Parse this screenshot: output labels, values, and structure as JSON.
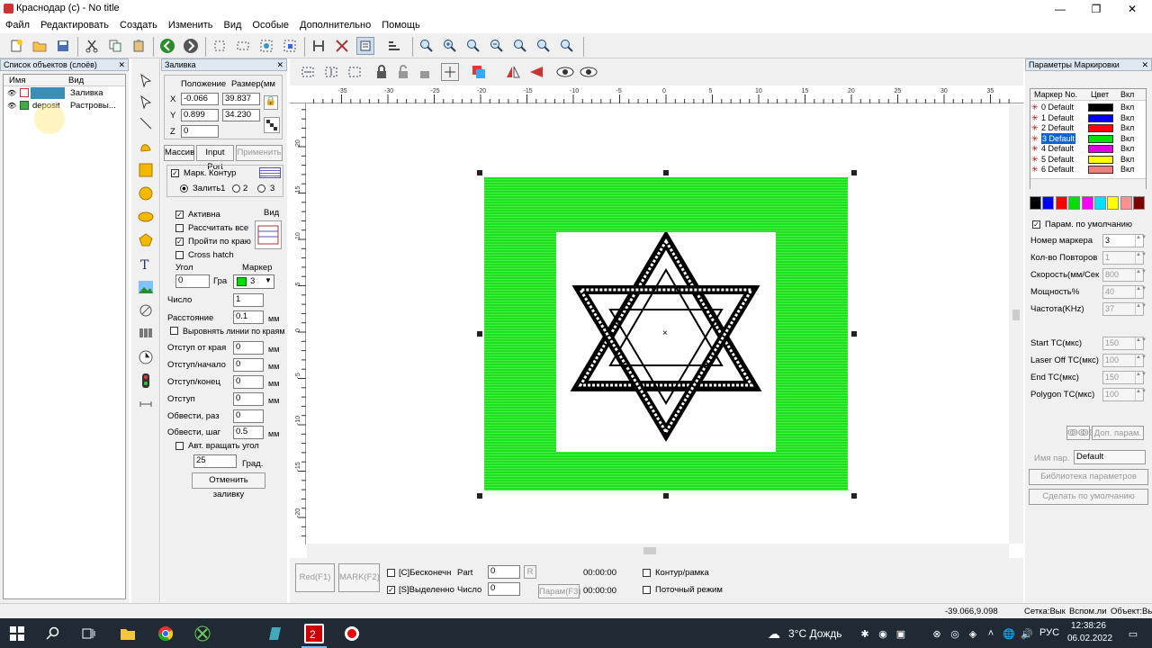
{
  "window": {
    "title": "Краснодар (c) - No title",
    "min": "—",
    "max": "❐",
    "close": "✕"
  },
  "menu": [
    "Файл",
    "Редактировать",
    "Создать",
    "Изменить",
    "Вид",
    "Особые",
    "Дополнительно",
    "Помощь"
  ],
  "objects_panel": {
    "title": "Список объектов (слоёв)",
    "col_name": "Имя",
    "col_view": "Вид",
    "rows": [
      {
        "name": "",
        "view": "Заливка"
      },
      {
        "name": "deposit",
        "view": "Растровы..."
      }
    ]
  },
  "fill_panel": {
    "title": "Заливка",
    "pos_label": "Положение",
    "size_label": "Размер(мм",
    "x_label": "X",
    "y_label": "Y",
    "z_label": "Z",
    "x": "-0.066",
    "y": "0.899",
    "z": "0",
    "w": "39.837",
    "h": "34.230",
    "tab_massive": "Массив",
    "tab_input": "Input Port",
    "apply": "Применить",
    "mark_contour": "Марк. Контур",
    "fill1": "Залить1",
    "fill2": "2",
    "fill3": "3",
    "active": "Активна",
    "calc_all": "Рассчитать все",
    "pass_edge": "Пройти по краю",
    "cross": "Cross hatch",
    "view_label": "Вид",
    "angle_label": "Угол",
    "angle": "0",
    "deg": "Гра",
    "marker_label": "Маркер",
    "marker": "3",
    "count_label": "Число",
    "count": "1",
    "dist_label": "Расстояние",
    "dist": "0.1",
    "mm": "мм",
    "align": "Выровнять линии по краям",
    "edge_off_label": "Отступ от края",
    "edge_off": "0",
    "start_off_label": "Отступ/начало",
    "start_off": "0",
    "end_off_label": "Отступ/конец",
    "end_off": "0",
    "off_label": "Отступ",
    "off": "0",
    "outline_times_label": "Обвести, раз",
    "outline_times": "0",
    "outline_step_label": "Обвести, шаг",
    "outline_step": "0.5",
    "auto_rotate": "Авт. вращать угол",
    "rot": "25",
    "grad": "Град.",
    "cancel": "Отменить заливку"
  },
  "ruler_labels": [
    "-35",
    "-30",
    "-25",
    "-20",
    "-15",
    "-10",
    "-5",
    "0",
    "5",
    "10",
    "15",
    "20",
    "25",
    "30",
    "35"
  ],
  "ruler_v_labels": [
    "25",
    "20",
    "15",
    "10",
    "5",
    "0",
    "-5",
    "-10",
    "-15",
    "-20"
  ],
  "bottom": {
    "red": "Red(F1)",
    "mark": "MARK(F2)",
    "infinite": "[C]Бесконечн",
    "part": "Part",
    "part_val": "0",
    "r": "R",
    "selected": "[S]Выделенно",
    "count": "Число",
    "count_val": "0",
    "param": "Парам(F3)",
    "time1": "00:00:00",
    "time2": "00:00:00",
    "contour": "Контур/рамка",
    "stream": "Поточный режим"
  },
  "status": {
    "coords": "-39.066,9.098",
    "grid": "Сетка:Вык",
    "aux": "Вспом.ли",
    "obj": "Объект:Вы"
  },
  "marking": {
    "title": "Параметры Маркировки",
    "col_no": "Маркер No.",
    "col_color": "Цвет",
    "col_on": "Вкл",
    "rows": [
      {
        "no": "0 Default",
        "color": "#000000",
        "on": "Вкл"
      },
      {
        "no": "1 Default",
        "color": "#0000ff",
        "on": "Вкл"
      },
      {
        "no": "2 Default",
        "color": "#ff0000",
        "on": "Вкл"
      },
      {
        "no": "3 Default",
        "color": "#00e000",
        "on": "Вкл"
      },
      {
        "no": "4 Default",
        "color": "#e000e0",
        "on": "Вкл"
      },
      {
        "no": "5 Default",
        "color": "#ffff00",
        "on": "Вкл"
      },
      {
        "no": "6 Default",
        "color": "#f08080",
        "on": "Вкл"
      }
    ],
    "palette": [
      "#000000",
      "#0000ff",
      "#ff0000",
      "#00e000",
      "#ff00ff",
      "#00e0ff",
      "#ffff00",
      "#ff9090",
      "#800000"
    ],
    "default_params": "Парам. по умолчанию",
    "fields": [
      {
        "label": "Номер маркера",
        "value": "3"
      },
      {
        "label": "Кол-во Повторов",
        "value": "1"
      },
      {
        "label": "Скорость(мм/Сек",
        "value": "800"
      },
      {
        "label": "Мощность%",
        "value": "40"
      },
      {
        "label": "Частота(KHz)",
        "value": "37"
      },
      {
        "label": "Start TC(мкс)",
        "value": "150"
      },
      {
        "label": "Laser Off TC(мкс)",
        "value": "100"
      },
      {
        "label": "End TC(мкс)",
        "value": "150"
      },
      {
        "label": "Polygon TC(мкс)",
        "value": "100"
      }
    ],
    "extra": "Доп. парам.",
    "name_label": "Имя пар.",
    "name": "Default",
    "lib": "Библиотека параметров",
    "make_default": "Сделать по умолчанию"
  },
  "taskbar": {
    "weather": "3°C  Дождь",
    "lang": "РУС",
    "time": "12:38:26",
    "date": "06.02.2022"
  }
}
